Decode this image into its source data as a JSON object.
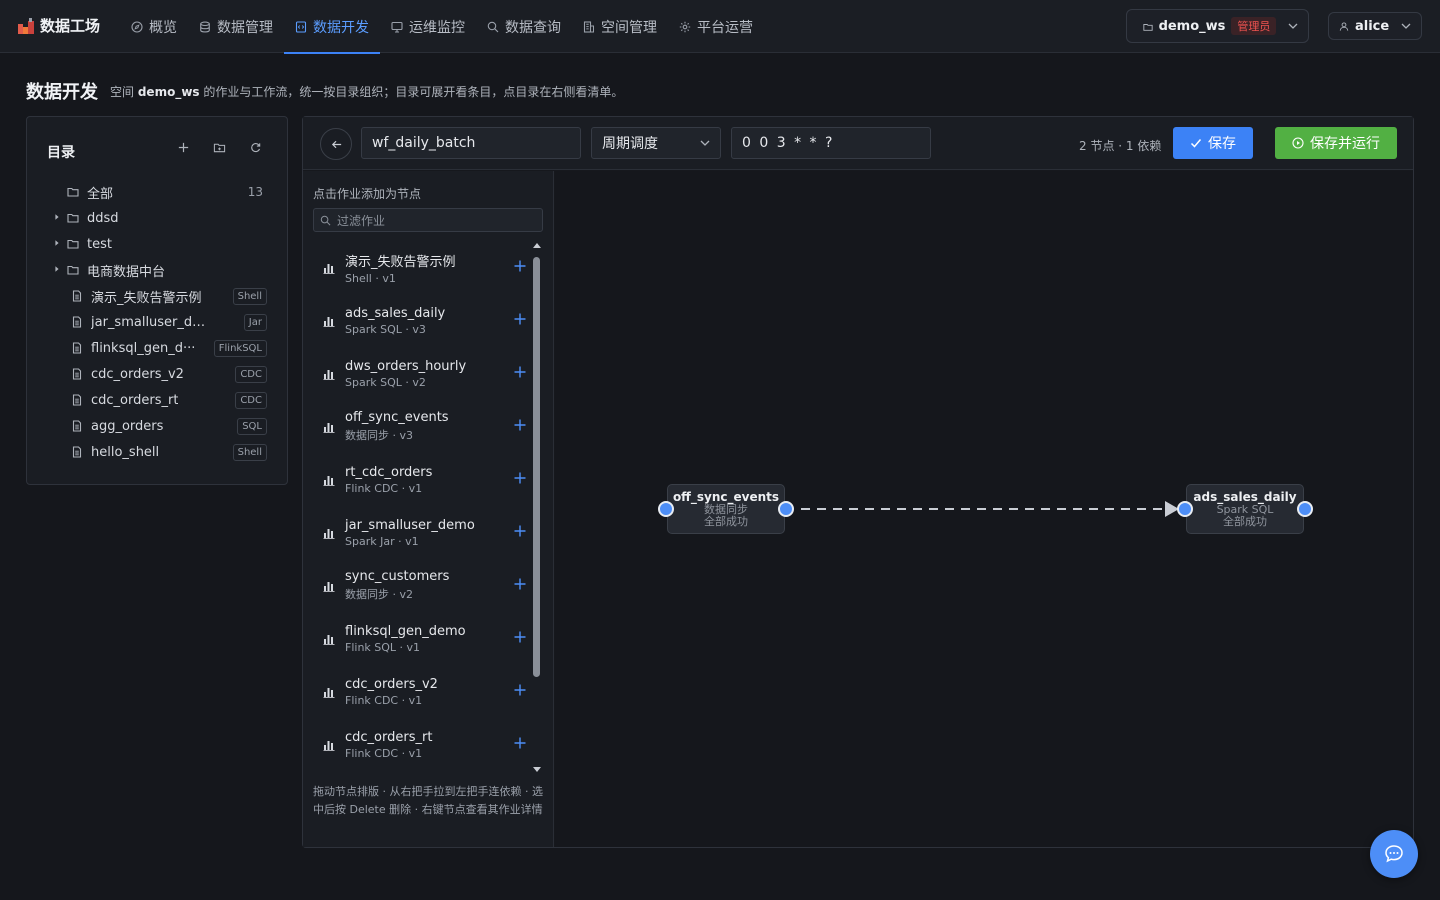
{
  "app": {
    "brand": "数据工场",
    "brand_icon": "factory-icon"
  },
  "nav": {
    "items": [
      {
        "label": "概览",
        "icon": "compass-icon",
        "active": false
      },
      {
        "label": "数据管理",
        "icon": "database-icon",
        "active": false
      },
      {
        "label": "数据开发",
        "icon": "code-file-icon",
        "active": true
      },
      {
        "label": "运维监控",
        "icon": "monitor-icon",
        "active": false
      },
      {
        "label": "数据查询",
        "icon": "search-icon",
        "active": false
      },
      {
        "label": "空间管理",
        "icon": "building-icon",
        "active": false
      },
      {
        "label": "平台运营",
        "icon": "gear-icon",
        "active": false
      }
    ],
    "active_color": "#5b9dff"
  },
  "workspace": {
    "name": "demo_ws",
    "role": "管理员"
  },
  "user": {
    "name": "alice"
  },
  "page": {
    "title": "数据开发",
    "desc_prefix": "空间",
    "desc_ws": "demo_ws",
    "desc_suffix": "的作业与工作流，统一按目录组织；目录可展开看条目，点目录在右侧看清单。"
  },
  "directory": {
    "title": "目录",
    "tools": [
      "plus-icon",
      "folder-icon",
      "refresh-icon"
    ],
    "items": [
      {
        "label": "全部",
        "kind": "root",
        "count": "13"
      },
      {
        "label": "ddsd",
        "kind": "folder"
      },
      {
        "label": "test",
        "kind": "folder"
      },
      {
        "label": "电商数据中台",
        "kind": "folder"
      },
      {
        "label": "演示_失败告警示例",
        "kind": "file",
        "tag": "Shell"
      },
      {
        "label": "jar_smalluser_demo",
        "kind": "file",
        "tag": "Jar"
      },
      {
        "label": "flinksql_gen_d···",
        "kind": "file",
        "tag": "FlinkSQL"
      },
      {
        "label": "cdc_orders_v2",
        "kind": "file",
        "tag": "CDC"
      },
      {
        "label": "cdc_orders_rt",
        "kind": "file",
        "tag": "CDC"
      },
      {
        "label": "agg_orders",
        "kind": "file",
        "tag": "SQL"
      },
      {
        "label": "hello_shell",
        "kind": "file",
        "tag": "Shell"
      }
    ]
  },
  "editor": {
    "workflow_name": "wf_daily_batch",
    "schedule_type": "周期调度",
    "cron": "0 0 3 * * ?",
    "stats": "2 节点 · 1 依赖",
    "save_label": "保存",
    "save_run_label": "保存并运行",
    "save_color": "#3c82f6",
    "run_color": "#52b043"
  },
  "jobs": {
    "hint": "点击作业添加为节点",
    "filter_placeholder": "过滤作业",
    "items": [
      {
        "name": "演示_失败告警示例",
        "meta": "Shell · v1"
      },
      {
        "name": "ads_sales_daily",
        "meta": "Spark SQL · v3"
      },
      {
        "name": "dws_orders_hourly",
        "meta": "Spark SQL · v2"
      },
      {
        "name": "off_sync_events",
        "meta": "数据同步 · v3"
      },
      {
        "name": "rt_cdc_orders",
        "meta": "Flink CDC · v1"
      },
      {
        "name": "jar_smalluser_demo",
        "meta": "Spark Jar · v1"
      },
      {
        "name": "sync_customers",
        "meta": "数据同步 · v2"
      },
      {
        "name": "flinksql_gen_demo",
        "meta": "Flink SQL · v1"
      },
      {
        "name": "cdc_orders_v2",
        "meta": "Flink CDC · v1"
      },
      {
        "name": "cdc_orders_rt",
        "meta": "Flink CDC · v1"
      }
    ],
    "footer": "拖动节点排版 · 从右把手拉到左把手连依赖 · 选中后按 Delete 删除 · 右键节点查看其作业详情"
  },
  "graph": {
    "nodes": [
      {
        "id": "n1",
        "name": "off_sync_events",
        "type": "数据同步",
        "status": "全部成功"
      },
      {
        "id": "n2",
        "name": "ads_sales_daily",
        "type": "Spark SQL",
        "status": "全部成功"
      }
    ],
    "edges": [
      {
        "from": "n1",
        "to": "n2",
        "style": "dashed"
      }
    ]
  },
  "chat": {
    "icon": "chat-bubble-icon"
  }
}
